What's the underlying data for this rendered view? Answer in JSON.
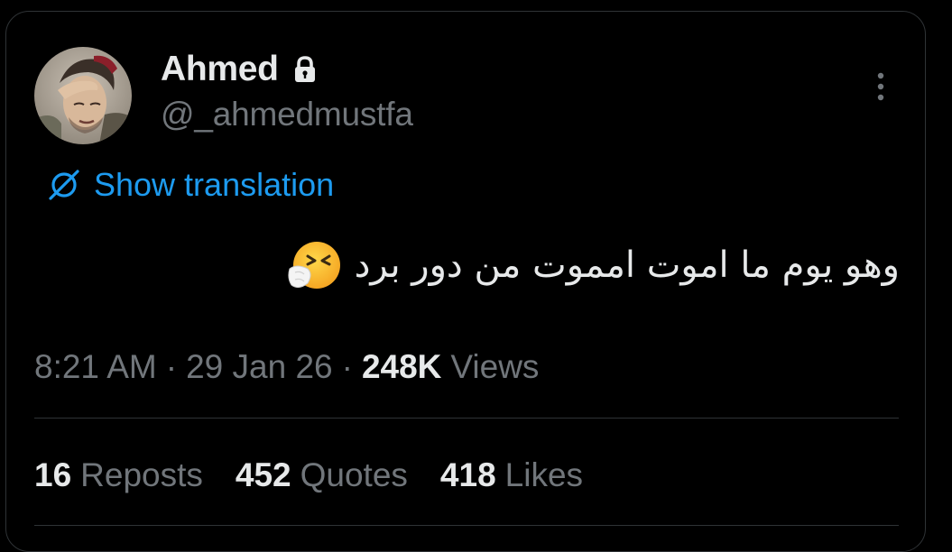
{
  "post": {
    "author": {
      "display_name": "Ahmed",
      "handle": "@_ahmedmustfa",
      "protected_icon": "lock-icon",
      "avatar_icon": "profile-photo"
    },
    "menu_icon": "more-vertical-icon",
    "translation": {
      "icon": "globe-slash-icon",
      "label": "Show translation"
    },
    "text": "وهو يوم ما اموت امموت من دور برد",
    "emoji": "sneezing-face",
    "meta": {
      "time": "8:21 AM",
      "separator": "·",
      "date": "29 Jan 26",
      "views_count": "248K",
      "views_label": "Views"
    },
    "stats": {
      "reposts": {
        "count": "16",
        "label": "Reposts"
      },
      "quotes": {
        "count": "452",
        "label": "Quotes"
      },
      "likes": {
        "count": "418",
        "label": "Likes"
      }
    }
  },
  "colors": {
    "background": "#000000",
    "primary_text": "#e7e9ea",
    "secondary_text": "#71767b",
    "link": "#1d9bf0",
    "border": "#2f3336"
  }
}
